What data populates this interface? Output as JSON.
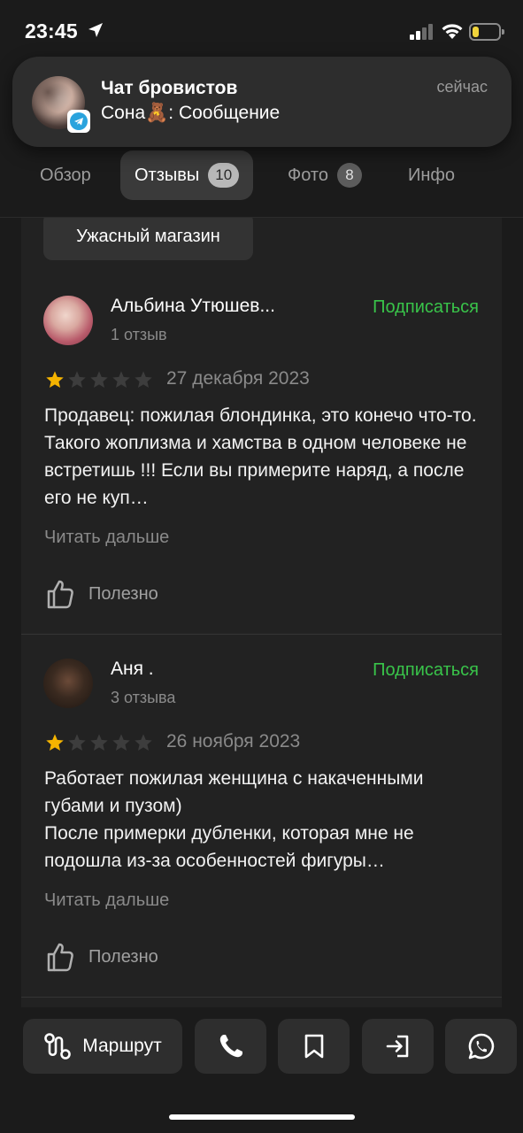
{
  "status_bar": {
    "time": "23:45"
  },
  "notification": {
    "title": "Чат бровистов",
    "message": "Сона🧸: Сообщение",
    "time": "сейчас"
  },
  "tabs": [
    {
      "label": "Обзор",
      "count": ""
    },
    {
      "label": "Отзывы",
      "count": "10"
    },
    {
      "label": "Фото",
      "count": "8"
    },
    {
      "label": "Инфо",
      "count": ""
    }
  ],
  "tag_chip": "Ужасный магазин",
  "reviews": [
    {
      "author": "Альбина Утюшев...",
      "review_count": "1 отзыв",
      "follow_label": "Подписаться",
      "rating": 1,
      "date": "27 декабря 2023",
      "text": "Продавец: пожилая блондинка, это конечо что-то. Такого жоплизма и хамства в одном человеке не встретишь !!! Если вы примерите наряд, а после его не куп…",
      "read_more": "Читать дальше",
      "useful_label": "Полезно"
    },
    {
      "author": "Аня .",
      "review_count": "3 отзыва",
      "follow_label": "Подписаться",
      "rating": 1,
      "date": "26 ноября 2023",
      "text": "Работает пожилая женщина с накаченными губами и пузом)\nПосле примерки дубленки, которая мне не подошла из-за особенностей фигуры…",
      "read_more": "Читать дальше",
      "useful_label": "Полезно"
    }
  ],
  "bottom_bar": {
    "route_label": "Маршрут",
    "icons": [
      "phone-icon",
      "bookmark-icon",
      "share-icon",
      "whatsapp-icon"
    ]
  },
  "colors": {
    "background": "#1b1b1b",
    "card": "#222222",
    "accent_green": "#39c44a",
    "star_filled": "#f5b400",
    "star_empty": "#3d3d3d"
  }
}
